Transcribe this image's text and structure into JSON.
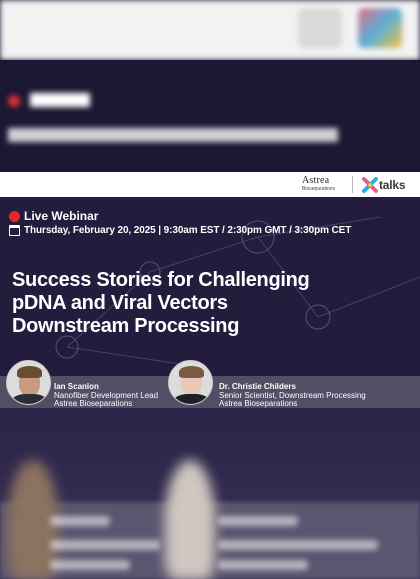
{
  "webinar": {
    "live_label": "Live Webinar",
    "datetime": "Thursday, February 20, 2025 | 9:30am EST / 2:30pm GMT / 3:30pm CET",
    "title_line1": "Success Stories for Challenging",
    "title_line2": "pDNA and Viral Vectors",
    "title_line3": "Downstream Processing"
  },
  "logos": {
    "astrea_name": "Astrea",
    "astrea_sub": "Bioseparations",
    "xtalks_text": "talks"
  },
  "speakers": [
    {
      "name": "Ian Scanlon",
      "role_line1": "Nanofiber Development Lead",
      "role_line2": "Astrea Bioseparations"
    },
    {
      "name": "Dr. Christie Childers",
      "role_line1": "Senior Scientist, Downstream Processing",
      "role_line2": "Astrea Bioseparations"
    }
  ],
  "colors": {
    "background": "#231c3d",
    "live_dot": "#e8262a",
    "speaker_band": "#534d66",
    "text": "#ffffff"
  },
  "icons": [
    "live-dot-icon",
    "calendar-icon",
    "astrea-logo",
    "xtalks-logo"
  ]
}
